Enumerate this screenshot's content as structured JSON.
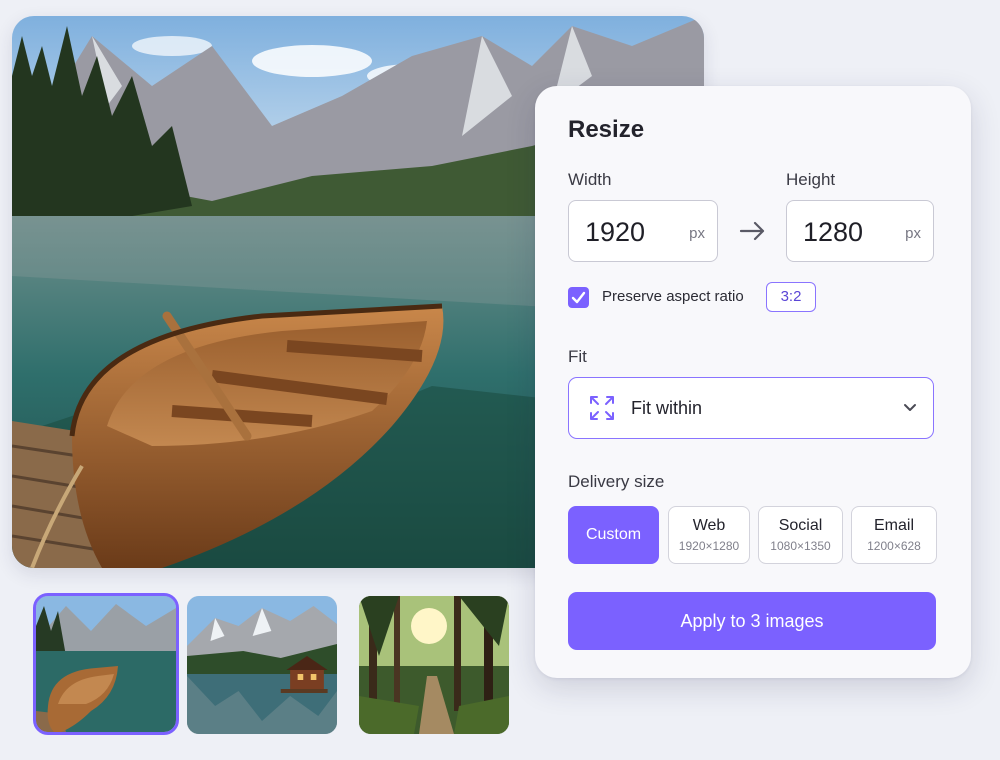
{
  "panel": {
    "title": "Resize",
    "width": {
      "label": "Width",
      "value": "1920",
      "unit": "px"
    },
    "height": {
      "label": "Height",
      "value": "1280",
      "unit": "px"
    },
    "preserve_aspect": {
      "label": "Preserve aspect ratio",
      "checked": true,
      "ratio": "3:2"
    },
    "fit": {
      "label": "Fit",
      "value": "Fit within"
    },
    "delivery": {
      "label": "Delivery size",
      "options": [
        {
          "name": "Custom",
          "dims": "",
          "selected": true
        },
        {
          "name": "Web",
          "dims": "1920×1280",
          "selected": false
        },
        {
          "name": "Social",
          "dims": "1080×1350",
          "selected": false
        },
        {
          "name": "Email",
          "dims": "1200×628",
          "selected": false
        }
      ]
    },
    "apply_label": "Apply to 3 images"
  },
  "thumbnails": [
    {
      "subject": "boat-on-mountain-lake",
      "selected": true
    },
    {
      "subject": "cabin-on-mountain-lake",
      "selected": false
    },
    {
      "subject": "forest-path-sunlight",
      "selected": false
    }
  ],
  "colors": {
    "accent": "#7b61ff",
    "panel_bg": "#f8f8fb",
    "page_bg": "#eef0f6"
  }
}
